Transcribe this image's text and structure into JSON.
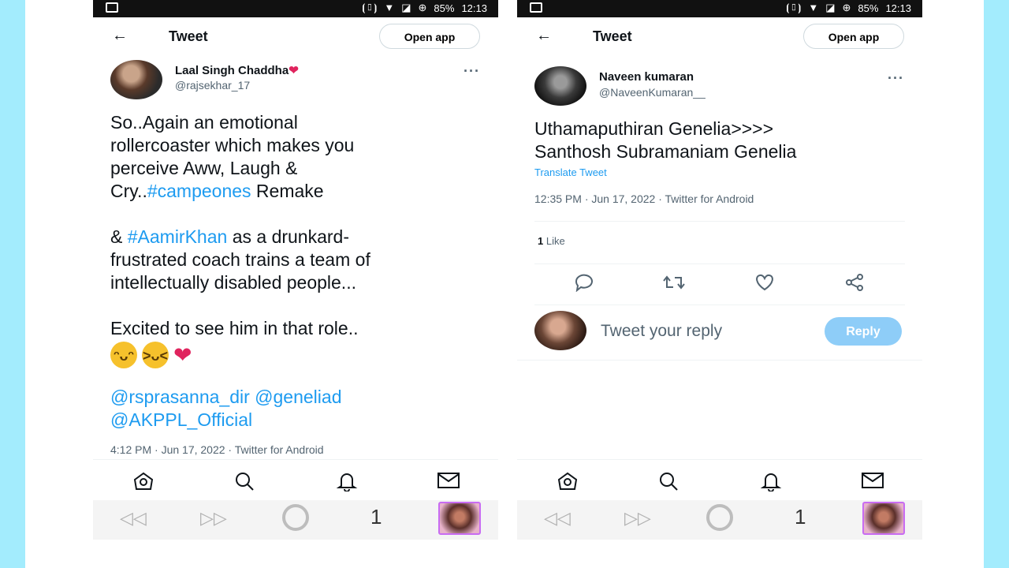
{
  "left_phone": {
    "status": {
      "battery": "85%",
      "time": "12:13"
    },
    "header": {
      "title": "Tweet",
      "open_app": "Open app"
    },
    "author": {
      "name": "Laal Singh Chaddha",
      "handle": "@rajsekhar_17"
    },
    "tweet": {
      "line1": "So..Again an emotional",
      "line2": "rollercoaster which makes you",
      "line3": "perceive Aww, Laugh &",
      "line4_pre": "Cry..",
      "line4_tag": "#campeones",
      "line4_post": " Remake",
      "para2_pre": "& ",
      "para2_tag": "#AamirKhan",
      "para2_post": " as a drunkard-",
      "para2_line2": "frustrated coach trains a team of",
      "para2_line3": "intellectually disabled  people...",
      "para3": "Excited to see him in that role..",
      "mention1": "@rsprasanna_dir",
      "mention2": "@geneliad",
      "mention3": "@AKPPL_Official"
    },
    "meta": "4:12 PM · Jun 17, 2022 · Twitter for Android",
    "tab_count": "1"
  },
  "right_phone": {
    "status": {
      "battery": "85%",
      "time": "12:13"
    },
    "header": {
      "title": "Tweet",
      "open_app": "Open app"
    },
    "author": {
      "name": "Naveen kumaran",
      "handle": "@NaveenKumaran__"
    },
    "tweet": {
      "line1": "Uthamaputhiran Genelia>>>>",
      "line2": "Santhosh Subramaniam Genelia",
      "translate": "Translate Tweet"
    },
    "meta": "12:35 PM · Jun 17, 2022 · Twitter for Android",
    "likes": {
      "count": "1",
      "label": "Like"
    },
    "reply": {
      "placeholder": "Tweet your reply",
      "button": "Reply"
    },
    "tab_count": "1"
  },
  "colors": {
    "link": "#1d9bf0",
    "background_side": "#a3ecfd",
    "reply_button": "#8ecdf8",
    "heart": "#e0245e"
  }
}
